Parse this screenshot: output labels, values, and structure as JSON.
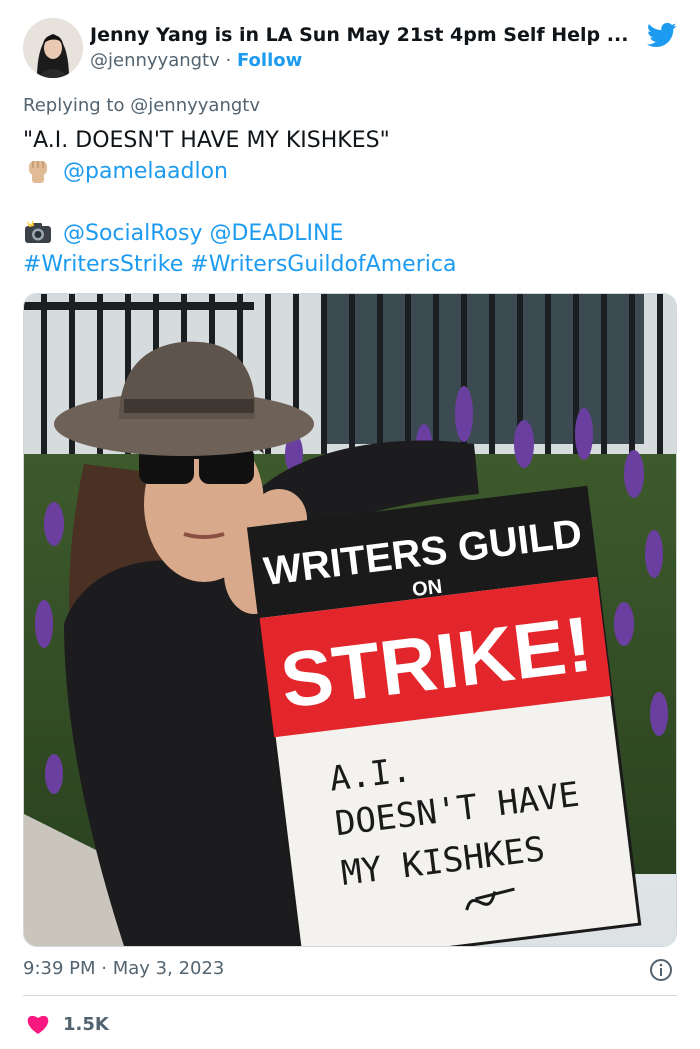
{
  "author": {
    "display_name": "Jenny Yang is in LA Sun May 21st 4pm Self Help ...",
    "handle": "@jennyyangtv",
    "separator": "·",
    "follow_label": "Follow"
  },
  "reply": {
    "prefix": "Replying to",
    "mention": "@jennyyangtv"
  },
  "tweet": {
    "line1": "\"A.I. DOESN'T HAVE MY KISHKES\"",
    "mention_pamela": "@pamelaadlon",
    "mention_rosy": "@SocialRosy",
    "mention_deadline": "@DEADLINE",
    "hashtag_strike": "#WritersStrike",
    "hashtag_guild": "#WritersGuildofAmerica"
  },
  "sign": {
    "line1": "WRITERS GUILD",
    "line2": "ON",
    "line3": "STRIKE!",
    "hand_line1": "A.I.",
    "hand_line2": "DOESN'T HAVE",
    "hand_line3": "MY KISHKES"
  },
  "meta": {
    "time": "9:39 PM",
    "separator": "·",
    "date": "May 3, 2023"
  },
  "engagement": {
    "likes": "1.5K"
  },
  "icons": {
    "bird": "twitter-bird-icon",
    "fist": "raised-fist-icon",
    "camera": "camera-flash-icon",
    "info": "info-icon",
    "heart": "heart-icon"
  },
  "colors": {
    "link": "#1d9bf0",
    "muted": "#536471",
    "heart": "#f91880",
    "sign_red": "#e3262b"
  }
}
